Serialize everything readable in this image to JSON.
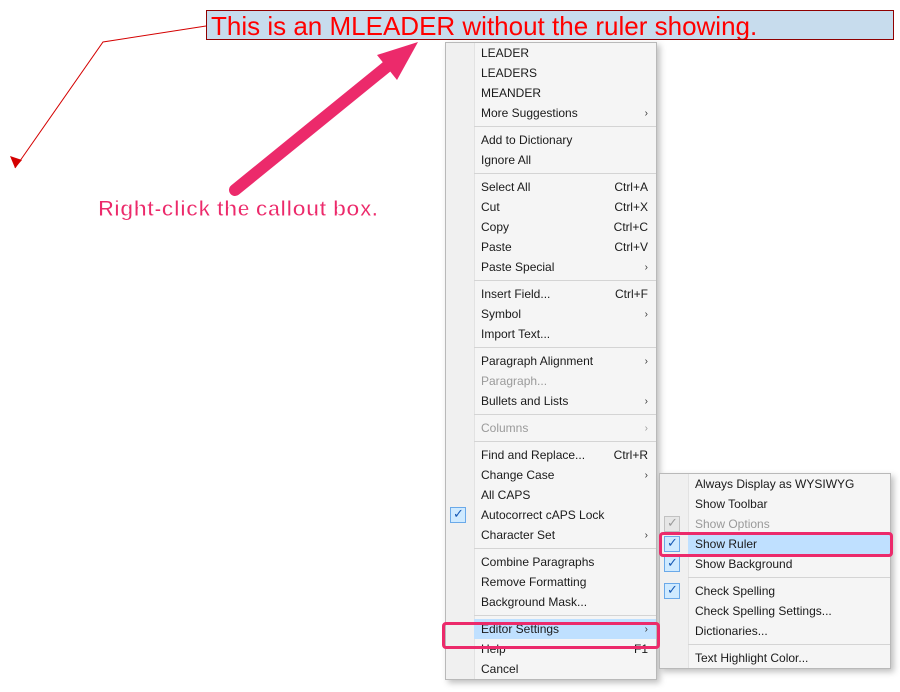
{
  "callout_text": "This is an MLEADER without the ruler showing.",
  "instruction": "Right-click the callout box.",
  "main_menu": {
    "group_spell": {
      "sug1": "LEADER",
      "sug2": "LEADERS",
      "sug3": "MEANDER",
      "more": "More Suggestions"
    },
    "group_dict": {
      "add": "Add to Dictionary",
      "ignore": "Ignore All"
    },
    "group_edit": {
      "select_all": "Select All",
      "select_all_sc": "Ctrl+A",
      "cut": "Cut",
      "cut_sc": "Ctrl+X",
      "copy": "Copy",
      "copy_sc": "Ctrl+C",
      "paste": "Paste",
      "paste_sc": "Ctrl+V",
      "paste_special": "Paste Special"
    },
    "group_insert": {
      "insert_field": "Insert Field...",
      "insert_field_sc": "Ctrl+F",
      "symbol": "Symbol",
      "import": "Import Text..."
    },
    "group_para": {
      "alignment": "Paragraph Alignment",
      "paragraph": "Paragraph...",
      "bullets": "Bullets and Lists"
    },
    "group_cols": {
      "columns": "Columns"
    },
    "group_find": {
      "find": "Find and Replace...",
      "find_sc": "Ctrl+R",
      "case": "Change Case",
      "allcaps": "All CAPS",
      "autocorrect": "Autocorrect cAPS Lock",
      "charset": "Character Set"
    },
    "group_fmt": {
      "combine": "Combine Paragraphs",
      "remove": "Remove Formatting",
      "bgmask": "Background Mask..."
    },
    "group_editor": {
      "editor": "Editor Settings",
      "help": "Help",
      "help_sc": "F1",
      "cancel": "Cancel"
    }
  },
  "sub_menu": {
    "wysiwyg": "Always Display as WYSIWYG",
    "toolbar": "Show Toolbar",
    "options": "Show Options",
    "ruler": "Show Ruler",
    "background": "Show Background",
    "spelling": "Check Spelling",
    "spelling_settings": "Check Spelling Settings...",
    "dictionaries": "Dictionaries...",
    "highlight": "Text Highlight Color..."
  }
}
